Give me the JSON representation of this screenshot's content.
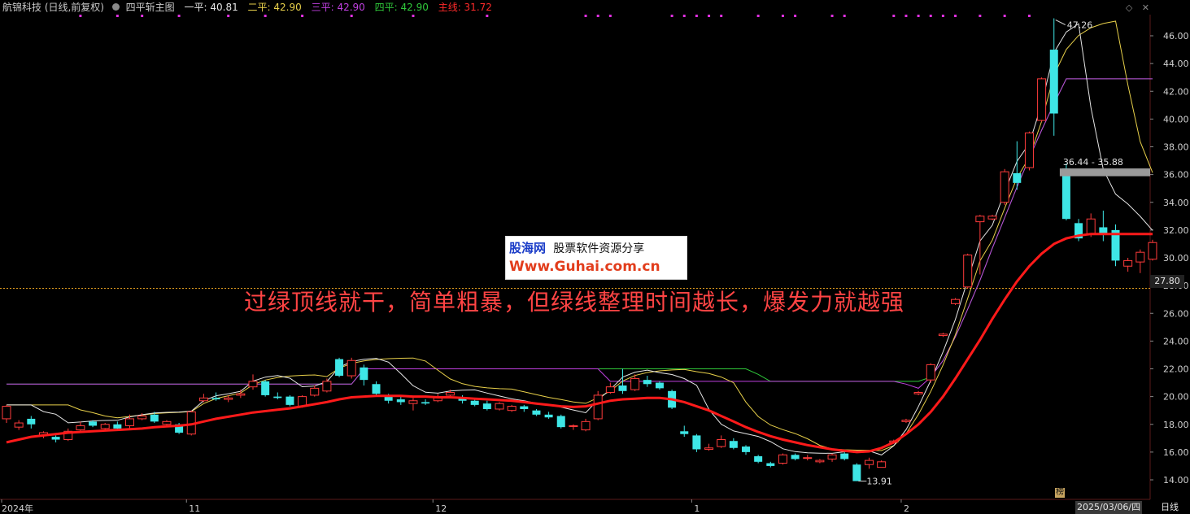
{
  "header": {
    "stock_title": "航锦科技 (日线,前复权)",
    "indicator_name": "四平斩主图",
    "labels": [
      {
        "text": "一平: 40.81",
        "color": "#e6e6e6"
      },
      {
        "text": "二平: 42.90",
        "color": "#e8d04a"
      },
      {
        "text": "三平: 42.90",
        "color": "#c040e0"
      },
      {
        "text": "四平: 42.90",
        "color": "#2fc83a"
      },
      {
        "text": "主线: 31.72",
        "color": "#ff2a2a"
      }
    ]
  },
  "overlay_text": "过绿顶线就干，简单粗暴，但绿线整理时间越长，爆发力就越强",
  "watermark": {
    "brand": "股海网",
    "slogan": "股票软件资源分享",
    "url": "Www.Guhai.com.cn"
  },
  "current_price_label": "27.80",
  "date_label": "2025/03/06/四",
  "period_label": "日线",
  "badge": "榜",
  "colors": {
    "up": "#ff3b3b",
    "down": "#3ee6e6",
    "ma_white": "#e6e6e6",
    "ma_yellow": "#e8d04a",
    "ma_purple": "#c040e0",
    "ma_green": "#2fc83a",
    "main_line": "#ff1a1a",
    "dots": "#e030e0",
    "price_line": "#e8a020"
  },
  "chart_data": {
    "type": "candlestick",
    "yaxis": {
      "ticks": [
        "46.00",
        "44.00",
        "42.00",
        "40.00",
        "38.00",
        "36.00",
        "34.00",
        "32.00",
        "30.00",
        "28.00",
        "26.00",
        "24.00",
        "22.00",
        "20.00",
        "18.00",
        "16.00",
        "14.00"
      ],
      "range": [
        13.0,
        47.8
      ]
    },
    "xaxis": {
      "labels": [
        {
          "text": "2024年",
          "index": 0
        },
        {
          "text": "11",
          "index": 15
        },
        {
          "text": "12",
          "index": 35
        },
        {
          "text": "1",
          "index": 56
        },
        {
          "text": "2",
          "index": 73
        }
      ]
    },
    "annotations": {
      "high": "47.26",
      "low": "13.91",
      "gap": "36.44 - 35.88"
    },
    "reference_price": 27.8,
    "candles": [
      [
        18.4,
        19.3,
        19.4,
        18.1
      ],
      [
        17.8,
        18.1,
        18.3,
        17.6
      ],
      [
        18.4,
        18.0,
        18.6,
        17.7
      ],
      [
        17.2,
        17.4,
        17.5,
        17.0
      ],
      [
        17.1,
        16.9,
        17.2,
        16.7
      ],
      [
        16.9,
        17.5,
        17.7,
        16.8
      ],
      [
        17.6,
        17.9,
        18.2,
        17.5
      ],
      [
        18.2,
        17.9,
        18.3,
        17.8
      ],
      [
        17.7,
        18.0,
        18.1,
        17.5
      ],
      [
        18.0,
        17.7,
        18.2,
        17.6
      ],
      [
        17.9,
        18.4,
        18.7,
        17.7
      ],
      [
        18.4,
        18.6,
        18.8,
        18.3
      ],
      [
        18.7,
        18.2,
        18.9,
        18.1
      ],
      [
        18.0,
        18.2,
        18.3,
        17.9
      ],
      [
        18.0,
        17.4,
        18.1,
        17.3
      ],
      [
        17.3,
        18.9,
        19.0,
        17.2
      ],
      [
        19.7,
        19.9,
        20.2,
        19.6
      ],
      [
        19.9,
        19.8,
        20.3,
        19.7
      ],
      [
        19.8,
        19.9,
        20.1,
        19.6
      ],
      [
        20.1,
        20.2,
        20.5,
        19.9
      ],
      [
        20.7,
        21.1,
        21.6,
        20.5
      ],
      [
        21.1,
        20.1,
        21.2,
        20.0
      ],
      [
        20.0,
        19.9,
        20.3,
        19.8
      ],
      [
        20.0,
        19.4,
        20.1,
        19.3
      ],
      [
        19.3,
        20.0,
        20.1,
        19.2
      ],
      [
        20.1,
        20.6,
        20.8,
        20.0
      ],
      [
        20.4,
        21.1,
        21.3,
        20.3
      ],
      [
        22.7,
        21.5,
        22.8,
        21.4
      ],
      [
        21.5,
        22.6,
        22.8,
        21.3
      ],
      [
        22.1,
        21.2,
        22.3,
        20.8
      ],
      [
        20.9,
        20.2,
        21.1,
        20.0
      ],
      [
        20.0,
        19.7,
        20.2,
        19.5
      ],
      [
        19.8,
        19.6,
        20.0,
        19.4
      ],
      [
        19.5,
        19.7,
        19.9,
        19.0
      ],
      [
        19.6,
        19.5,
        19.8,
        19.4
      ],
      [
        19.7,
        20.0,
        20.2,
        19.6
      ],
      [
        20.1,
        20.3,
        20.5,
        19.9
      ],
      [
        19.9,
        19.7,
        20.1,
        19.5
      ],
      [
        19.7,
        19.4,
        19.9,
        19.3
      ],
      [
        19.5,
        19.1,
        19.7,
        19.0
      ],
      [
        19.1,
        19.5,
        19.6,
        19.0
      ],
      [
        19.0,
        19.3,
        19.4,
        18.9
      ],
      [
        19.3,
        19.1,
        19.4,
        18.9
      ],
      [
        19.0,
        18.7,
        19.1,
        18.6
      ],
      [
        18.7,
        18.5,
        18.9,
        18.4
      ],
      [
        18.6,
        17.8,
        18.7,
        17.7
      ],
      [
        17.9,
        17.9,
        18.0,
        17.6
      ],
      [
        17.6,
        18.2,
        18.4,
        17.5
      ],
      [
        18.4,
        20.1,
        20.4,
        18.3
      ],
      [
        20.3,
        20.7,
        21.0,
        20.2
      ],
      [
        20.8,
        20.4,
        22.0,
        20.2
      ],
      [
        20.5,
        21.3,
        21.6,
        20.4
      ],
      [
        21.2,
        20.9,
        21.5,
        20.7
      ],
      [
        21.0,
        20.6,
        21.1,
        20.5
      ],
      [
        20.4,
        19.2,
        20.5,
        19.1
      ],
      [
        17.5,
        17.3,
        17.9,
        17.1
      ],
      [
        17.2,
        16.2,
        17.3,
        16.0
      ],
      [
        16.2,
        16.3,
        16.6,
        16.1
      ],
      [
        16.4,
        16.9,
        17.2,
        16.3
      ],
      [
        16.8,
        16.3,
        17.0,
        16.2
      ],
      [
        16.4,
        16.0,
        16.5,
        15.8
      ],
      [
        15.7,
        15.3,
        15.8,
        15.2
      ],
      [
        15.2,
        15.0,
        15.3,
        14.9
      ],
      [
        15.2,
        15.8,
        15.9,
        15.1
      ],
      [
        15.8,
        15.5,
        15.9,
        15.4
      ],
      [
        15.6,
        15.6,
        15.8,
        15.4
      ],
      [
        15.3,
        15.4,
        15.5,
        15.2
      ],
      [
        15.5,
        15.8,
        15.9,
        15.3
      ],
      [
        15.9,
        15.5,
        16.1,
        15.4
      ],
      [
        15.1,
        13.91,
        15.2,
        13.91
      ],
      [
        15.1,
        15.4,
        15.6,
        14.8
      ],
      [
        14.9,
        15.3,
        15.4,
        14.9
      ],
      [
        16.7,
        16.8,
        16.9,
        16.6
      ],
      [
        18.2,
        18.3,
        18.4,
        18.1
      ],
      [
        20.2,
        20.3,
        20.4,
        20.1
      ],
      [
        21.2,
        22.3,
        22.4,
        21.0
      ],
      [
        24.4,
        24.5,
        24.6,
        24.3
      ],
      [
        26.7,
        27.0,
        27.1,
        26.6
      ],
      [
        27.9,
        30.2,
        30.3,
        27.8
      ],
      [
        32.6,
        33.0,
        33.1,
        28.8
      ],
      [
        32.8,
        33.0,
        33.1,
        32.7
      ],
      [
        34.0,
        36.2,
        36.4,
        33.8
      ],
      [
        36.1,
        35.4,
        38.4,
        34.9
      ],
      [
        36.5,
        39.0,
        39.1,
        36.3
      ],
      [
        39.9,
        42.9,
        43.0,
        39.8
      ],
      [
        45.0,
        40.4,
        47.26,
        38.8
      ],
      [
        36.44,
        32.8,
        36.8,
        32.7
      ],
      [
        32.5,
        31.4,
        32.8,
        31.2
      ],
      [
        31.7,
        32.8,
        33.2,
        31.5
      ],
      [
        32.2,
        31.7,
        33.4,
        31.2
      ],
      [
        32.0,
        29.8,
        32.4,
        29.4
      ],
      [
        29.4,
        29.8,
        30.0,
        29.0
      ],
      [
        29.7,
        30.4,
        30.6,
        28.9
      ],
      [
        29.9,
        31.1,
        31.3,
        29.8
      ]
    ],
    "main_line": [
      16.7,
      16.9,
      17.1,
      17.2,
      17.3,
      17.4,
      17.45,
      17.5,
      17.55,
      17.6,
      17.65,
      17.7,
      17.8,
      17.85,
      17.9,
      18.0,
      18.2,
      18.4,
      18.55,
      18.7,
      18.85,
      18.95,
      19.05,
      19.15,
      19.3,
      19.45,
      19.6,
      19.8,
      19.95,
      20.0,
      20.05,
      20.05,
      20.05,
      20.0,
      20.0,
      19.95,
      19.95,
      19.9,
      19.85,
      19.8,
      19.75,
      19.7,
      19.6,
      19.5,
      19.4,
      19.3,
      19.25,
      19.3,
      19.5,
      19.7,
      19.8,
      19.85,
      19.9,
      19.9,
      19.8,
      19.6,
      19.3,
      19.0,
      18.6,
      18.2,
      17.8,
      17.45,
      17.15,
      16.9,
      16.7,
      16.5,
      16.35,
      16.2,
      16.1,
      16.0,
      16.05,
      16.3,
      16.7,
      17.3,
      18.0,
      18.9,
      20.0,
      21.3,
      22.7,
      24.1,
      25.6,
      27.0,
      28.3,
      29.4,
      30.3,
      31.0,
      31.4,
      31.6,
      31.72,
      31.72,
      31.72,
      31.72,
      31.72,
      31.72
    ],
    "green_line": [
      20.9,
      20.9,
      20.9,
      20.9,
      20.9,
      20.9,
      20.9,
      20.9,
      20.9,
      20.9,
      20.9,
      20.9,
      20.9,
      20.9,
      20.9,
      20.9,
      20.9,
      20.9,
      20.9,
      20.9,
      20.9,
      20.9,
      20.9,
      20.9,
      20.9,
      20.9,
      20.9,
      20.9,
      20.9,
      22.0,
      22.0,
      22.0,
      22.0,
      22.0,
      22.0,
      22.0,
      22.0,
      22.0,
      22.0,
      22.0,
      22.0,
      22.0,
      22.0,
      22.0,
      22.0,
      22.0,
      22.0,
      22.0,
      22.0,
      22.0,
      22.0,
      22.0,
      22.0,
      22.0,
      22.0,
      22.0,
      22.0,
      22.0,
      22.0,
      22.0,
      22.0,
      21.6,
      21.1,
      21.1,
      21.1,
      21.1,
      21.1,
      21.1,
      21.1,
      21.1,
      21.1,
      21.1,
      21.1,
      21.1,
      21.1,
      21.4,
      22.6,
      24.3,
      26.3,
      28.4,
      30.7,
      32.9,
      35.1,
      37.2,
      39.2,
      41.1,
      42.9,
      42.9,
      42.9,
      42.9,
      42.9,
      42.9,
      42.9,
      42.9
    ],
    "purple_line": [
      20.9,
      20.9,
      20.9,
      20.9,
      20.9,
      20.9,
      20.9,
      20.9,
      20.9,
      20.9,
      20.9,
      20.9,
      20.9,
      20.9,
      20.9,
      20.9,
      20.9,
      20.9,
      20.9,
      20.9,
      20.9,
      20.9,
      20.9,
      20.9,
      20.9,
      20.9,
      20.9,
      20.9,
      20.9,
      22.0,
      22.0,
      22.0,
      22.0,
      22.0,
      22.0,
      22.0,
      22.0,
      22.0,
      22.0,
      22.0,
      22.0,
      22.0,
      22.0,
      22.0,
      22.0,
      22.0,
      22.0,
      22.0,
      22.0,
      21.1,
      21.1,
      21.1,
      21.1,
      21.1,
      21.1,
      21.1,
      21.1,
      21.1,
      21.1,
      21.1,
      21.1,
      21.1,
      21.1,
      21.1,
      21.1,
      21.1,
      21.1,
      21.1,
      21.1,
      21.1,
      21.1,
      21.1,
      21.1,
      20.9,
      20.6,
      21.4,
      22.6,
      24.3,
      26.3,
      28.4,
      30.7,
      32.9,
      35.1,
      37.2,
      39.2,
      41.1,
      42.9,
      42.9,
      42.9,
      42.9,
      42.9,
      42.9,
      42.9,
      42.9
    ]
  }
}
